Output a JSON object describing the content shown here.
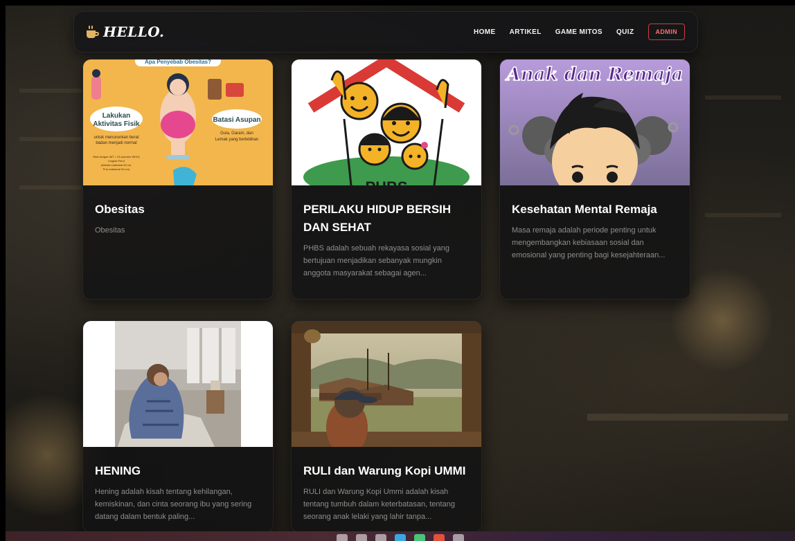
{
  "brand": {
    "name": "HELLO.",
    "icon": "coffee-cup-icon"
  },
  "nav": {
    "items": [
      "HOME",
      "ARTIKEL",
      "GAME MITOS",
      "QUIZ"
    ],
    "admin": "ADMIN"
  },
  "cards": [
    {
      "title": "Obesitas",
      "desc": "Obesitas",
      "image": {
        "heading": "Apa Penyebab Obesitas?",
        "left_title": "Lakukan Aktivitas Fisik",
        "left_sub": "untuk menurunkan berat badan menjadi normal",
        "left_note": "Nilai dengan IMT = 25 (sumber WHO) Lingkar Perut (Wanita maksimal 80 cm, Pria maksimal 90 cm)",
        "right_title": "Batasi Asupan",
        "right_sub": "Gula, Garam, dan Lemak yang berlebihan"
      }
    },
    {
      "title": "PERILAKU HIDUP BERSIH DAN SEHAT",
      "desc": "PHBS adalah sebuah rekayasa sosial yang bertujuan menjadikan sebanyak mungkin anggota masyarakat sebagai agen...",
      "image": {
        "caption": "PHBS"
      }
    },
    {
      "title": "Kesehatan Mental Remaja",
      "desc": "Masa remaja adalah periode penting untuk mengembangkan kebiasaan sosial dan emosional yang penting bagi kesejahteraan...",
      "image": {
        "heading": "Anak dan Remaja"
      }
    },
    {
      "title": "HENING",
      "desc": "Hening adalah kisah tentang kehilangan, kemiskinan, dan cinta seorang ibu yang sering datang dalam bentuk paling..."
    },
    {
      "title": "RULI dan Warung Kopi UMMI",
      "desc": "RULI dan Warung Kopi Ummi adalah kisah tentang tumbuh dalam keterbatasan, tentang seorang anak lelaki yang lahir tanpa..."
    }
  ],
  "colors": {
    "admin": "#ff6d6d",
    "brand_icon": "#e2b365",
    "card_bg": "#121214"
  }
}
